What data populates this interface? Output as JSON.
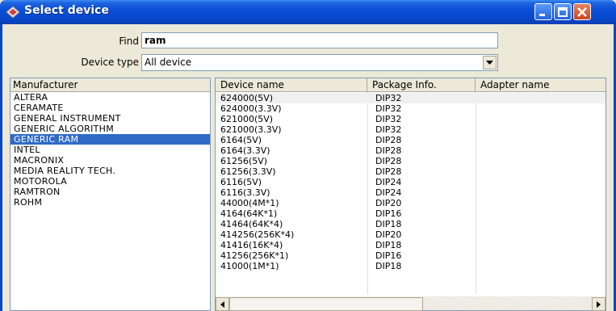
{
  "window": {
    "title": "Select device",
    "accent": "#0846C8",
    "selection_color": "#316AC5"
  },
  "titlebar": {
    "icon": "device-app-icon",
    "buttons": [
      "minimize-icon",
      "maximize-icon",
      "close-icon"
    ]
  },
  "find": {
    "label": "Find",
    "value": "ram"
  },
  "device_type": {
    "label": "Device type",
    "value": "All device"
  },
  "manufacturer": {
    "header": "Manufacturer",
    "items": [
      "ALTERA",
      "CERAMATE",
      "GENERAL INSTRUMENT",
      "GENERIC ALGORITHM",
      "GENERIC RAM",
      "INTEL",
      "MACRONIX",
      "MEDIA REALITY TECH.",
      "MOTOROLA",
      "RAMTRON",
      "ROHM"
    ],
    "selected": "GENERIC RAM"
  },
  "devices": {
    "headers": [
      "Device name",
      "Package Info.",
      "Adapter name"
    ],
    "rows": [
      [
        "624000(5V)",
        "DIP32",
        ""
      ],
      [
        "624000(3.3V)",
        "DIP32",
        ""
      ],
      [
        "621000(5V)",
        "DIP32",
        ""
      ],
      [
        "621000(3.3V)",
        "DIP32",
        ""
      ],
      [
        "6164(5V)",
        "DIP28",
        ""
      ],
      [
        "6164(3.3V)",
        "DIP28",
        ""
      ],
      [
        "61256(5V)",
        "DIP28",
        ""
      ],
      [
        "61256(3.3V)",
        "DIP28",
        ""
      ],
      [
        "6116(5V)",
        "DIP24",
        ""
      ],
      [
        "6116(3.3V)",
        "DIP24",
        ""
      ],
      [
        "44000(4M*1)",
        "DIP20",
        ""
      ],
      [
        "4164(64K*1)",
        "DIP16",
        ""
      ],
      [
        "41464(64K*4)",
        "DIP18",
        ""
      ],
      [
        "414256(256K*4)",
        "DIP20",
        ""
      ],
      [
        "41416(16K*4)",
        "DIP18",
        ""
      ],
      [
        "41256(256K*1)",
        "DIP16",
        ""
      ],
      [
        "41000(1M*1)",
        "DIP18",
        ""
      ]
    ]
  }
}
